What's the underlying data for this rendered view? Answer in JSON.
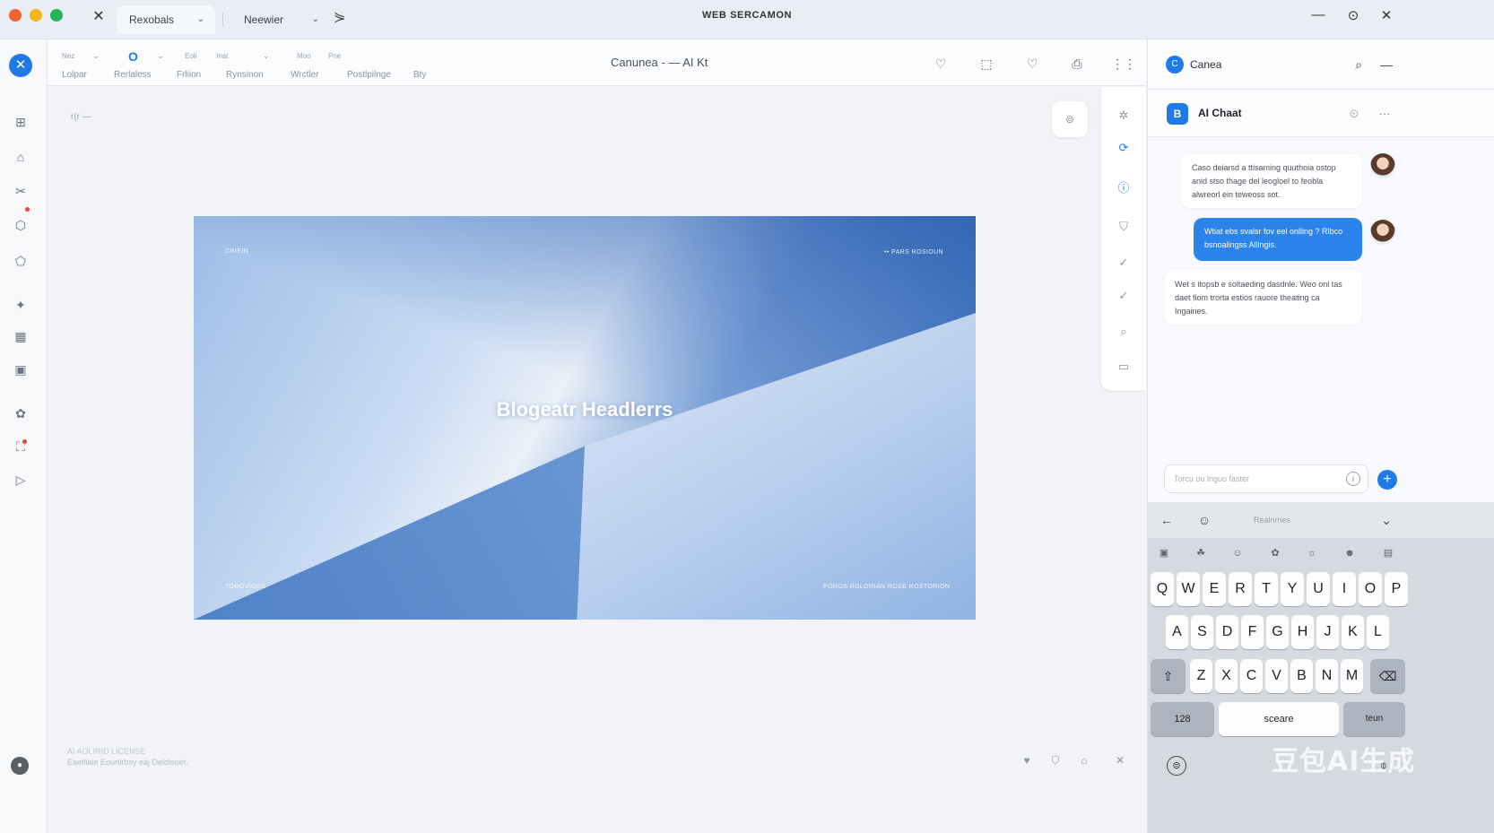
{
  "window": {
    "title": "WEB SERCAMON",
    "close_glyph": "✕",
    "tabs": [
      {
        "label": "Rexobals",
        "chevron": "⌄"
      },
      {
        "label": "Neewier",
        "chevron": "⌄"
      }
    ],
    "tab_add_glyph": "⋟",
    "controls": [
      "—",
      "⊙",
      "✕"
    ]
  },
  "leftrail": {
    "close_glyph": "✕",
    "icons": [
      "dashboard-icon",
      "home-icon",
      "scissors-icon",
      "shape-icon",
      "pentagon-icon",
      "sparkle-icon",
      "grid-icon",
      "media-icon",
      "puzzle-icon",
      "apps-icon",
      "play-icon"
    ],
    "icon_glyphs": [
      "⊞",
      "⌂",
      "✂",
      "⬡",
      "⬠",
      "✦",
      "▦",
      "▣",
      "✿",
      "⛶",
      "▷"
    ],
    "bottom_glyph": "●"
  },
  "toolbar": {
    "items": [
      {
        "top": "Nez",
        "bottom": "Lolpar"
      },
      {
        "top": "O",
        "bottom": "Rerlaless"
      },
      {
        "top": "Eoli",
        "bottom": "Frliion"
      },
      {
        "top": "Inat",
        "bottom": "Rynsinon"
      },
      {
        "top": "Moo",
        "bottom": "Wrctler"
      },
      {
        "top": "Pne",
        "bottom": "Postlpilnge"
      },
      {
        "top": "",
        "bottom": "Bty"
      }
    ],
    "chevron": "⌄",
    "doc_title": "Canunea - — AI Kt",
    "right_icons": [
      "heart-outline-icon",
      "frame-icon",
      "heart-icon",
      "share-icon",
      "menu-dots-icon"
    ],
    "right_glyphs": [
      "♡",
      "⬚",
      "♡",
      "⎙",
      "⋮⋮"
    ]
  },
  "canvas": {
    "zoom_label": "r(r —",
    "badge_glyph": "⊚",
    "artboard": {
      "headline": "Blogeatr Headlerrs",
      "corner_tl": "CRIEIN",
      "corner_tr": "•• PARS ROSIOUN",
      "corner_bl": "TOROVIORS",
      "corner_br": "POROS ROLORIAN ROSE ROSTORION"
    },
    "side_icons": [
      "sparkle-icon",
      "refresh-icon",
      "info-icon",
      "shield-icon",
      "check-icon",
      "checkmark-icon",
      "search-icon",
      "comment-icon"
    ],
    "side_glyphs": [
      "✲",
      "⟳",
      "ⓘ",
      "⛉",
      "✓",
      "✓",
      "⌕",
      "▭"
    ],
    "footer_line1": "AI AOLIRID LICENSE",
    "footer_line2": "Eaetliaie Eourtirbsy eaj Deldisoet.",
    "footer_icons": [
      "heart-icon",
      "shield-icon",
      "gift-icon",
      "close-icon"
    ],
    "footer_glyphs": [
      "♥",
      "⛉",
      "⌂",
      "✕"
    ]
  },
  "panel": {
    "brand": "Canea",
    "search_glyph": "⌕",
    "collapse_glyph": "—",
    "chat_title": "AI Chaat",
    "chat_avatar_glyph": "B",
    "history_glyph": "⏲",
    "more_glyph": "···",
    "messages": [
      {
        "from": "user",
        "text": "Caso deiarsd a ttisaming quuthoia ostop anid stso thage del leogloel to feobla alwreorl ein teweoss sot."
      },
      {
        "from": "user_highlight",
        "text": "Wtiat ebs svalsr fov eel onlling ? Rlbco bsnoalingss Alllngis."
      },
      {
        "from": "ai",
        "text": "Wet s itopsb e soltaeding dasdnle. Weo onl tas daet fiom trorta estios rauore theating ca Ingaines."
      }
    ],
    "input_placeholder": "Torcu ou lnguo faster",
    "input_info_glyph": "i",
    "send_glyph": "+"
  },
  "keyboard": {
    "suggestion": "Realnrnes",
    "back_glyph": "←",
    "emoji_glyph": "☺",
    "collapse_glyph": "⌄",
    "emoji_row": [
      "▣",
      "☘",
      "☺",
      "✿",
      "☼",
      "☻",
      "▤"
    ],
    "row1": [
      "Q",
      "W",
      "E",
      "R",
      "T",
      "Y",
      "U",
      "I",
      "O",
      "P"
    ],
    "row2": [
      "A",
      "S",
      "D",
      "F",
      "G",
      "H",
      "J",
      "K",
      "L"
    ],
    "row3": [
      "Z",
      "X",
      "C",
      "V",
      "B",
      "N",
      "M"
    ],
    "shift_glyph": "⇧",
    "backspace_glyph": "⌫",
    "numbers_label": "128",
    "space_label": "sceare",
    "return_label": "teun",
    "globe_glyph": "⊜",
    "mic_glyph": "⌽"
  },
  "watermark": "豆包AI生成"
}
